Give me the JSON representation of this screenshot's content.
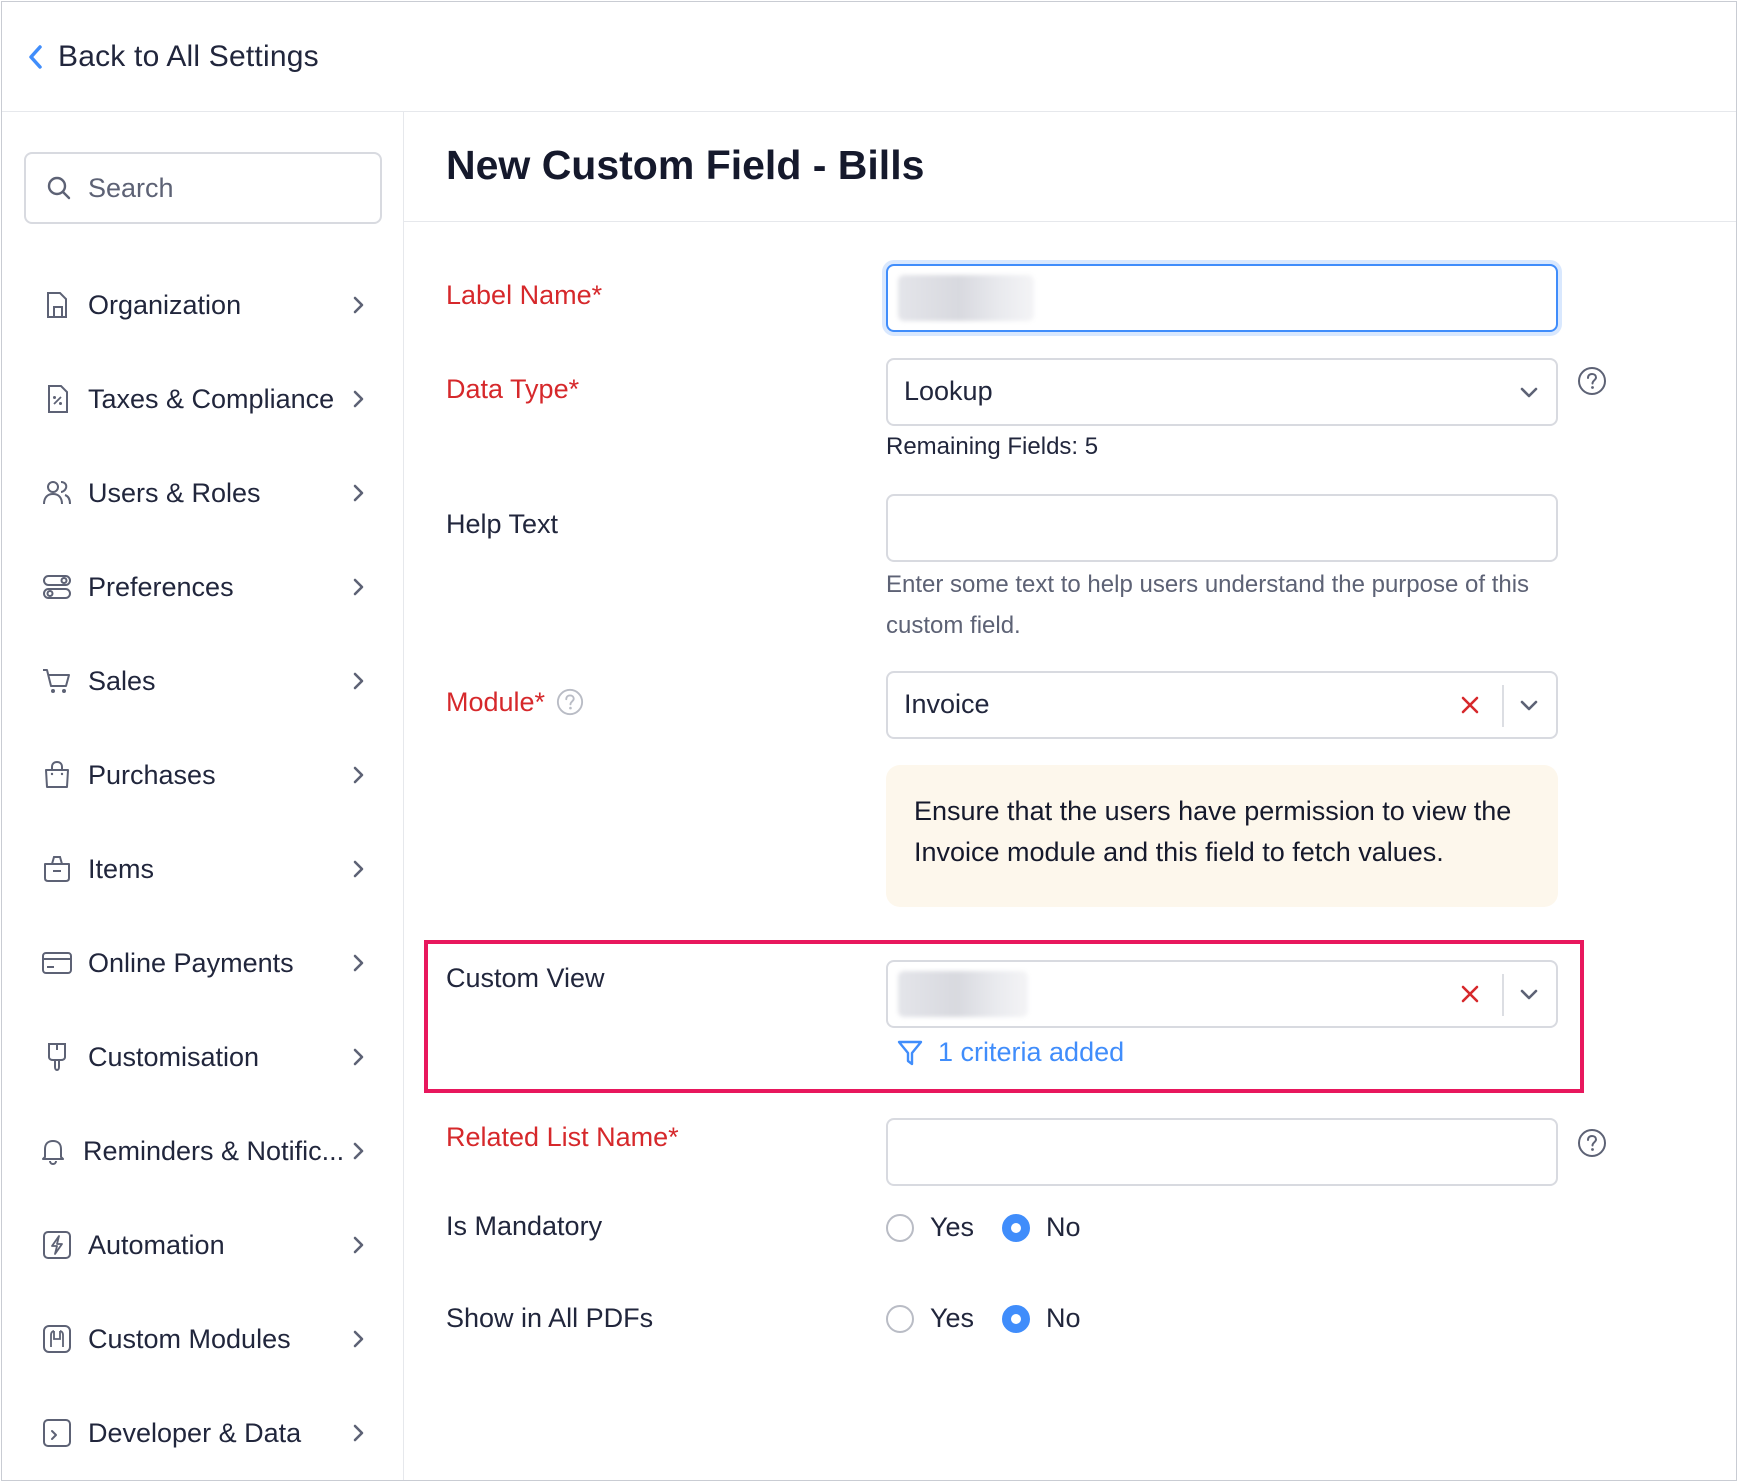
{
  "header": {
    "back_label": "Back to All Settings"
  },
  "sidebar": {
    "search_placeholder": "Search",
    "items": [
      {
        "label": "Organization",
        "icon": "building-icon"
      },
      {
        "label": "Taxes & Compliance",
        "icon": "tax-document-icon"
      },
      {
        "label": "Users & Roles",
        "icon": "users-icon"
      },
      {
        "label": "Preferences",
        "icon": "toggles-icon"
      },
      {
        "label": "Sales",
        "icon": "cart-icon"
      },
      {
        "label": "Purchases",
        "icon": "shopping-bag-icon"
      },
      {
        "label": "Items",
        "icon": "basket-icon"
      },
      {
        "label": "Online Payments",
        "icon": "credit-card-icon"
      },
      {
        "label": "Customisation",
        "icon": "brush-icon"
      },
      {
        "label": "Reminders & Notific...",
        "icon": "bell-icon"
      },
      {
        "label": "Automation",
        "icon": "lightning-icon"
      },
      {
        "label": "Custom Modules",
        "icon": "module-icon"
      },
      {
        "label": "Developer & Data",
        "icon": "terminal-icon"
      }
    ]
  },
  "main": {
    "title": "New Custom Field - Bills",
    "fields": {
      "label_name": {
        "label": "Label Name*"
      },
      "data_type": {
        "label": "Data Type*",
        "value": "Lookup",
        "remaining": "Remaining Fields: 5"
      },
      "help_text": {
        "label": "Help Text",
        "hint": "Enter some text to help users understand the purpose of this custom field."
      },
      "module": {
        "label": "Module*",
        "value": "Invoice"
      },
      "info": "Ensure that the users have permission to view the Invoice module and this field to fetch values.",
      "custom_view": {
        "label": "Custom View",
        "criteria": "1 criteria added"
      },
      "related_list": {
        "label": "Related List Name*"
      },
      "is_mandatory": {
        "label": "Is Mandatory",
        "yes": "Yes",
        "no": "No",
        "selected": "No"
      },
      "show_in_pdfs": {
        "label": "Show in All PDFs",
        "yes": "Yes",
        "no": "No",
        "selected": "No"
      }
    }
  },
  "colors": {
    "accent": "#408dfb",
    "required": "#d6282b",
    "highlight": "#e8175d",
    "info_bg": "#fdf7ec"
  }
}
